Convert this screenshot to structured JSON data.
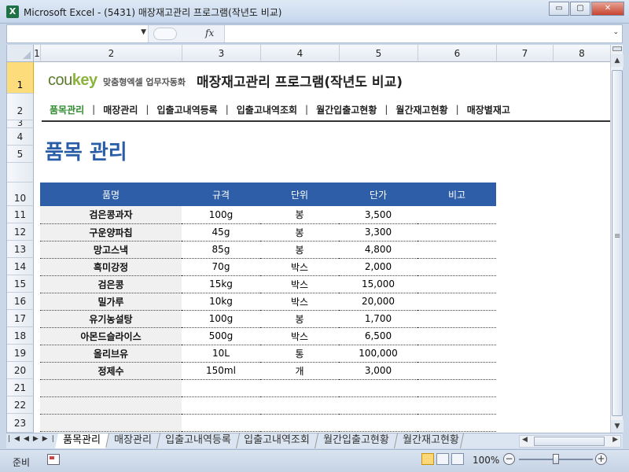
{
  "window": {
    "app_icon": "X",
    "title": "Microsoft Excel - (5431) 매장재고관리 프로그램(작년도 비교)",
    "min": "▭",
    "max": "▢",
    "close": "✕"
  },
  "formula_bar": {
    "name_box": "",
    "fx": "fx",
    "formula": ""
  },
  "columns": [
    "1",
    "2",
    "3",
    "4",
    "5",
    "6",
    "7",
    "8"
  ],
  "rows": [
    "1",
    "2",
    "3",
    "4",
    "5",
    "",
    "10",
    "11",
    "12",
    "13",
    "14",
    "15",
    "16",
    "17",
    "18",
    "19",
    "20",
    "21",
    "22",
    "23"
  ],
  "header": {
    "logo_a": "cou",
    "logo_b": "key",
    "logo_sub": "맞춤형엑셀 업무자동화",
    "title": "매장재고관리 프로그램(작년도 비교)"
  },
  "nav": [
    "품목관리",
    "매장관리",
    "입출고내역등록",
    "입출고내역조회",
    "월간입출고현황",
    "월간재고현황",
    "매장별재고"
  ],
  "section_title": "품목 관리",
  "table": {
    "columns": [
      "품명",
      "규격",
      "단위",
      "단가",
      "비고"
    ],
    "rows": [
      [
        "검은콩과자",
        "100g",
        "봉",
        "3,500",
        ""
      ],
      [
        "구운양파칩",
        "45g",
        "봉",
        "3,300",
        ""
      ],
      [
        "망고스낵",
        "85g",
        "봉",
        "4,800",
        ""
      ],
      [
        "흑미강정",
        "70g",
        "박스",
        "2,000",
        ""
      ],
      [
        "검은콩",
        "15kg",
        "박스",
        "15,000",
        ""
      ],
      [
        "밀가루",
        "10kg",
        "박스",
        "20,000",
        ""
      ],
      [
        "유기농설탕",
        "100g",
        "봉",
        "1,700",
        ""
      ],
      [
        "아몬드슬라이스",
        "500g",
        "박스",
        "6,500",
        ""
      ],
      [
        "올리브유",
        "10L",
        "통",
        "100,000",
        ""
      ],
      [
        "정제수",
        "150ml",
        "개",
        "3,000",
        ""
      ],
      [
        "",
        "",
        "",
        "",
        ""
      ],
      [
        "",
        "",
        "",
        "",
        ""
      ],
      [
        "",
        "",
        "",
        "",
        ""
      ]
    ]
  },
  "sheet_tabs": [
    "품목관리",
    "매장관리",
    "입출고내역등록",
    "입출고내역조회",
    "월간입출고현황",
    "월간재고현황"
  ],
  "status": {
    "ready": "준비",
    "zoom": "100%",
    "zoom_level_percent": 100
  }
}
